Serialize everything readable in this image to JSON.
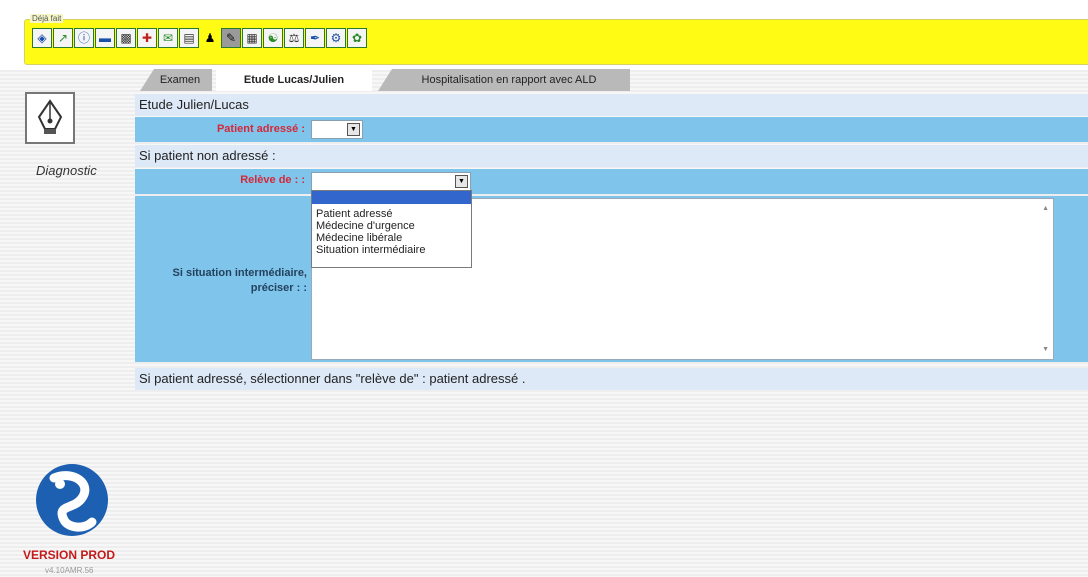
{
  "toolbar": {
    "fieldset_label": "Déjà fait",
    "icons": [
      "book-icon",
      "chart-icon",
      "info-icon",
      "eraser-icon",
      "xray-icon",
      "medkit-icon",
      "mail-icon",
      "books-icon",
      "people-icon",
      "pencil-icon",
      "grid-icon",
      "group-icon",
      "scale-icon",
      "pen-icon",
      "gear-icon",
      "feather-icon"
    ]
  },
  "sidebar": {
    "diagnostic_label": "Diagnostic",
    "version_label": "VERSION PROD",
    "version_sub": "v4.10AMR.56"
  },
  "tabs": [
    {
      "label": "Examen",
      "active": false
    },
    {
      "label": "Etude Lucas/Julien",
      "active": true
    },
    {
      "label": "Hospitalisation en rapport avec ALD",
      "active": false
    }
  ],
  "form": {
    "section_title": "Etude Julien/Lucas",
    "patient_adresse_label": "Patient adressé :",
    "patient_adresse_value": "",
    "non_adresse_heading": "Si patient non adressé :",
    "releve_de_label": "Relève de : :",
    "releve_de_value": "",
    "releve_de_options": [
      "Patient adressé",
      "Médecine d'urgence",
      "Médecine libérale",
      "Situation intermédiaire"
    ],
    "situation_label_line1": "Si situation intermédiaire,",
    "situation_label_line2": "préciser : :",
    "situation_value": "",
    "footer_note": "Si patient adressé, sélectionner dans \"relève de\" : patient adressé ."
  },
  "colors": {
    "toolbar_bg": "#fffb15",
    "row_blue": "#7fc4ea",
    "row_light": "#dde9f7",
    "label_red": "#d4283a",
    "version_red": "#c41a1a"
  }
}
